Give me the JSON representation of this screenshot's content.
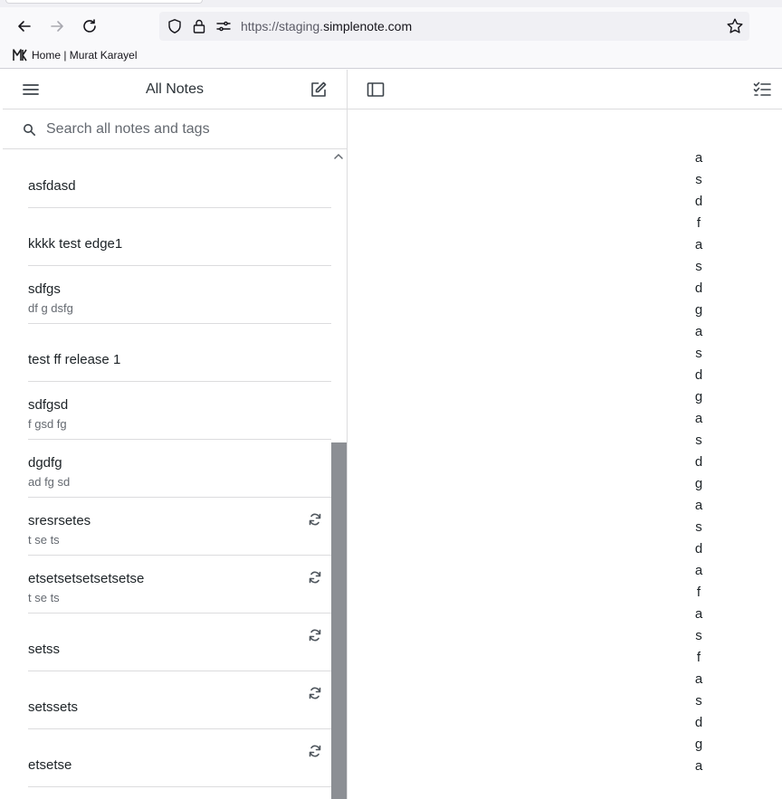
{
  "browser": {
    "url_prefix": "https://staging.",
    "url_domain": "simplenote.com",
    "bookmark_label": "Home | Murat Karayel"
  },
  "app": {
    "list_title": "All Notes",
    "search_placeholder": "Search all notes and tags",
    "notes": [
      {
        "title": "asfdasd",
        "preview": "",
        "syncing": false
      },
      {
        "title": "kkkk test edge1",
        "preview": "",
        "syncing": false
      },
      {
        "title": "sdfgs",
        "preview": "df g dsfg",
        "syncing": false
      },
      {
        "title": "test ff release 1",
        "preview": "",
        "syncing": false
      },
      {
        "title": "sdfgsd",
        "preview": "f gsd fg",
        "syncing": false
      },
      {
        "title": "dgdfg",
        "preview": "ad fg sd",
        "syncing": false
      },
      {
        "title": "sresrsetes",
        "preview": "t se ts",
        "syncing": true
      },
      {
        "title": "etsetsetsetsetsetse",
        "preview": "t se ts",
        "syncing": true
      },
      {
        "title": "setss",
        "preview": "",
        "syncing": true
      },
      {
        "title": "setssets",
        "preview": "",
        "syncing": true
      },
      {
        "title": "etsetse",
        "preview": "",
        "syncing": true
      }
    ],
    "editor_chars": [
      "a",
      "s",
      "d",
      "f",
      "a",
      "s",
      "d",
      "g",
      "a",
      "s",
      "d",
      "g",
      "a",
      "s",
      "d",
      "g",
      "a",
      "s",
      "d",
      "a",
      "f",
      "a",
      "s",
      "f",
      "a",
      "s",
      "d",
      "g",
      "a"
    ]
  },
  "icons": {
    "back": "arrow-left-icon",
    "forward": "arrow-right-icon",
    "reload": "reload-icon",
    "shield": "shield-icon",
    "lock": "lock-icon",
    "permissions": "permissions-icon",
    "bookmark_star": "star-icon",
    "menu": "hamburger-menu-icon",
    "new_note": "new-note-icon",
    "sidebar": "sidebar-toggle-icon",
    "checklist": "checklist-icon",
    "sync": "sync-icon"
  },
  "colors": {
    "text": "#2c3338",
    "muted": "#646970",
    "divider": "#dcdcde",
    "scrollbar": "#8c8f94"
  }
}
